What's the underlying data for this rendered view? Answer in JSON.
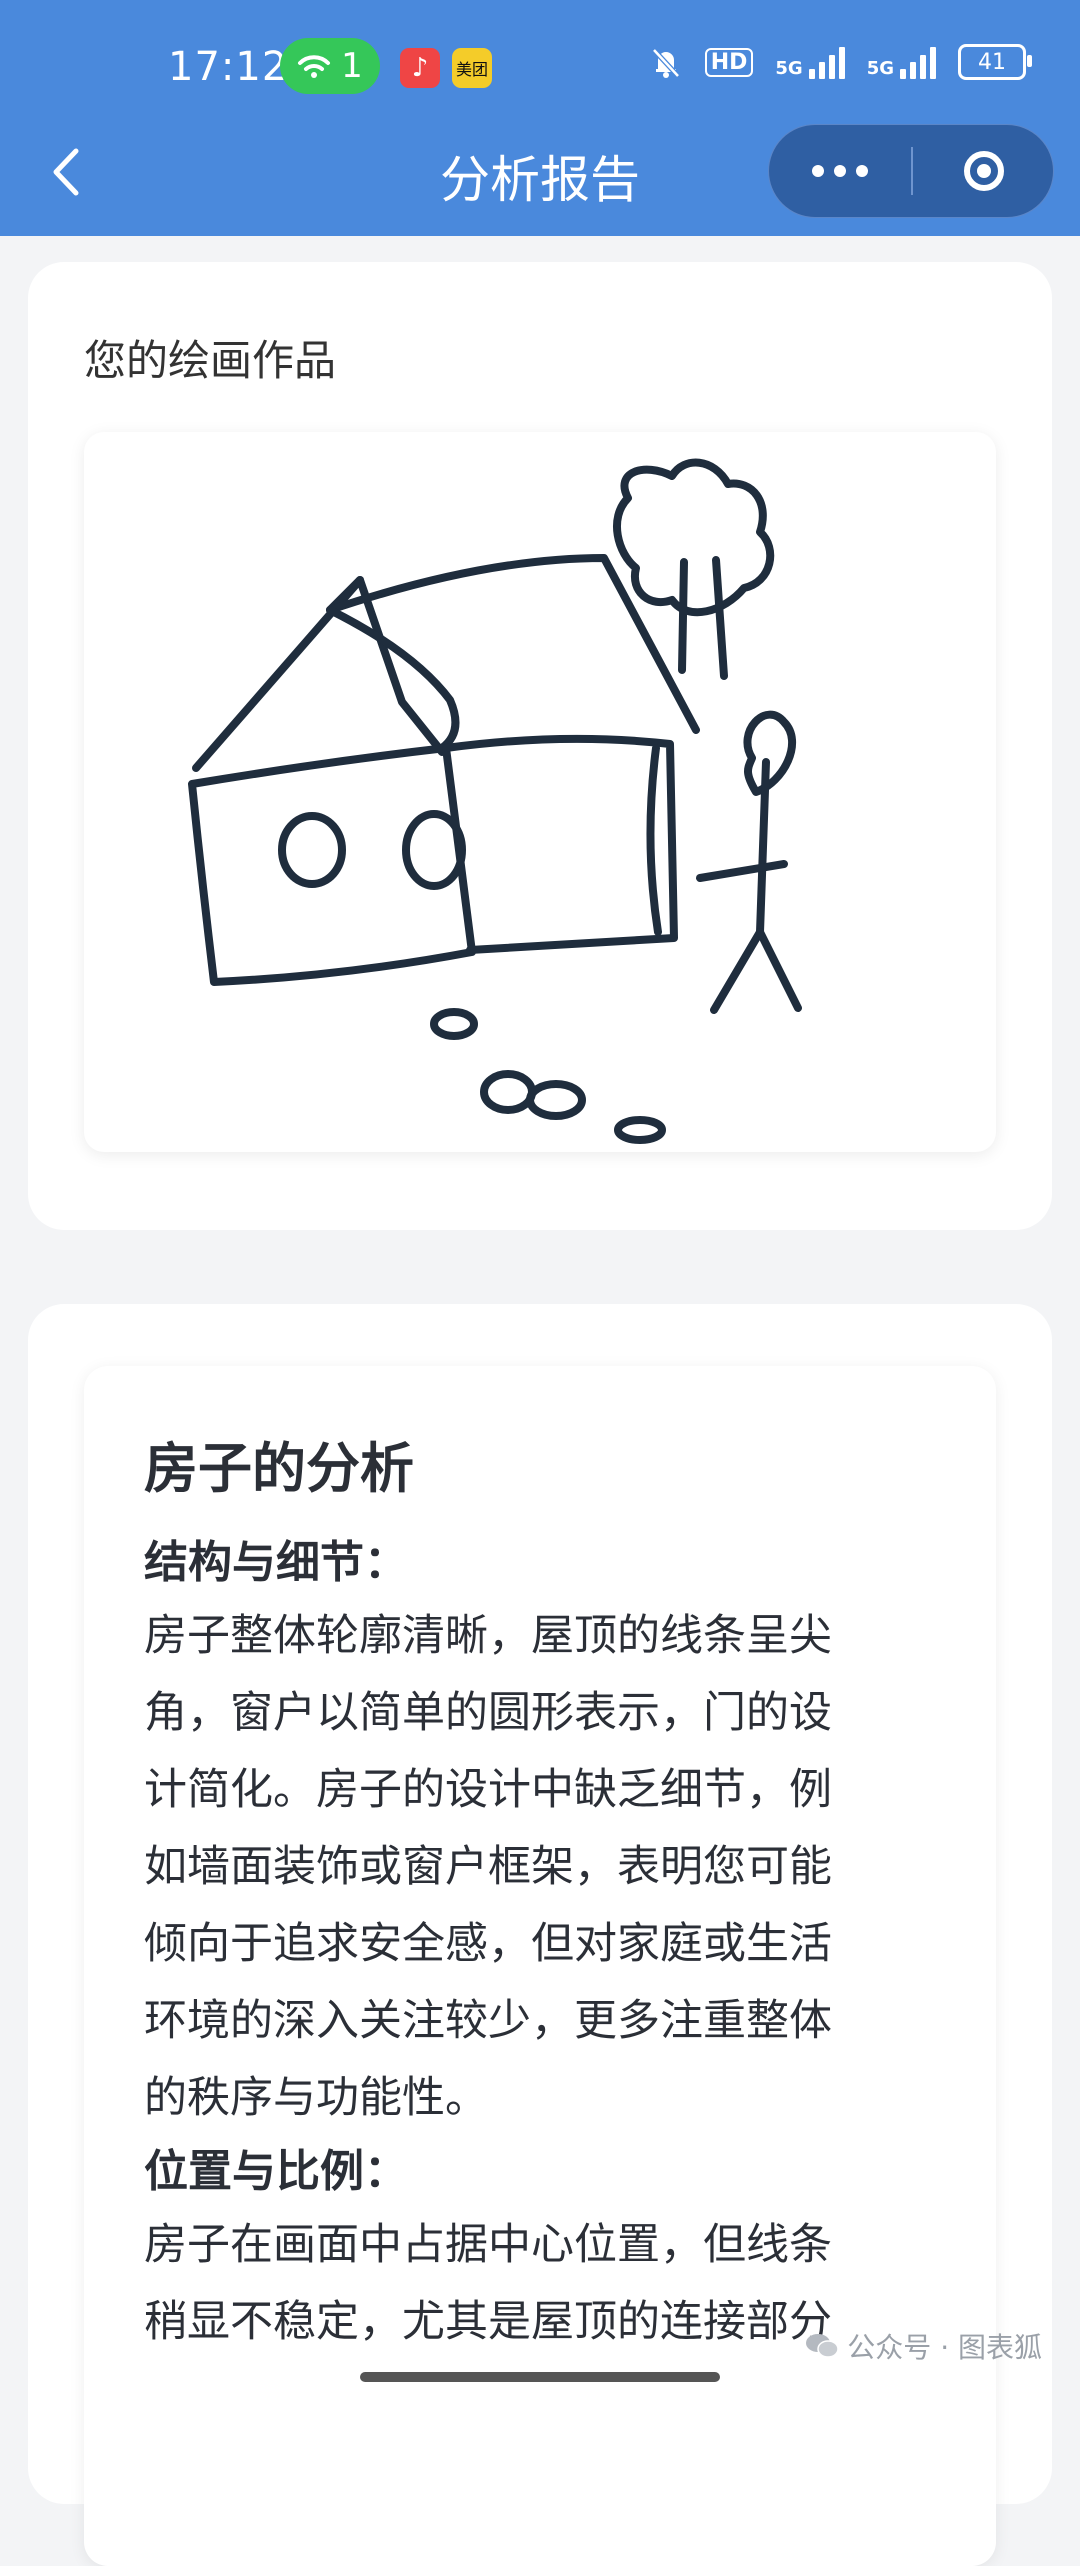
{
  "status_bar": {
    "time": "17:12",
    "wifi_count": "1",
    "app_badge_2": "美团",
    "net1": "5G",
    "net2": "5G",
    "hd": "HD",
    "battery": "41"
  },
  "nav": {
    "title": "分析报告"
  },
  "drawing_card": {
    "title": "您的绘画作品"
  },
  "analysis": {
    "heading": "房子的分析",
    "sections": [
      {
        "subheading": "结构与细节：",
        "lines": [
          "房子整体轮廓清晰，屋顶的线条呈尖",
          "角，窗户以简单的圆形表示，门的设",
          "计简化。房子的设计中缺乏细节，例",
          "如墙面装饰或窗户框架，表明您可能",
          "倾向于追求安全感，但对家庭或生活",
          "环境的深入关注较少，更多注重整体",
          "的秩序与功能性。"
        ]
      },
      {
        "subheading": "位置与比例：",
        "lines": [
          "房子在画面中占据中心位置，但线条",
          "稍显不稳定，尤其是屋顶的连接部分"
        ]
      }
    ]
  },
  "watermark": "公众号 · 图表狐",
  "colors": {
    "header": "#4a89dc",
    "capsule": "#2f5fa3",
    "ink": "#1f2d3d"
  }
}
